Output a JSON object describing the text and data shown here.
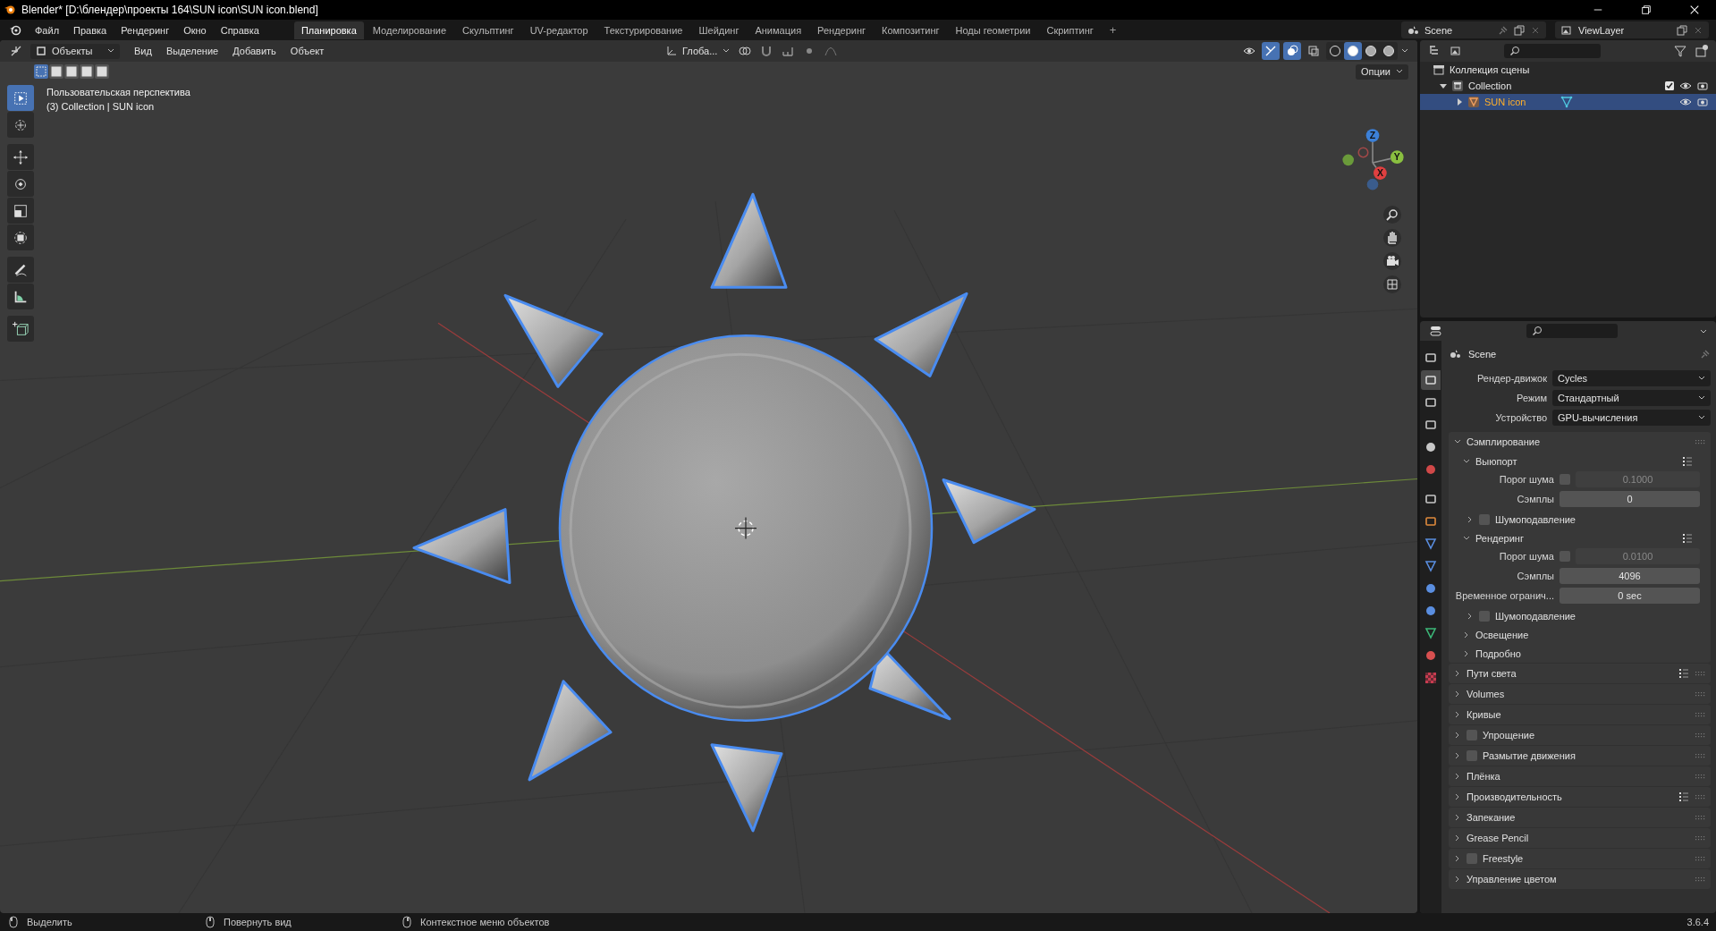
{
  "window": {
    "title": "Blender* [D:\\блендер\\проекты 164\\SUN icon\\SUN icon.blend]"
  },
  "menu": [
    "Файл",
    "Правка",
    "Рендеринг",
    "Окно",
    "Справка"
  ],
  "workspaces": [
    {
      "label": "Планировка",
      "selected": true
    },
    {
      "label": "Моделирование",
      "selected": false
    },
    {
      "label": "Скульптинг",
      "selected": false
    },
    {
      "label": "UV-редактор",
      "selected": false
    },
    {
      "label": "Текстурирование",
      "selected": false
    },
    {
      "label": "Шейдинг",
      "selected": false
    },
    {
      "label": "Анимация",
      "selected": false
    },
    {
      "label": "Рендеринг",
      "selected": false
    },
    {
      "label": "Композитинг",
      "selected": false
    },
    {
      "label": "Ноды геометрии",
      "selected": false
    },
    {
      "label": "Скриптинг",
      "selected": false
    }
  ],
  "add_workspace": "+",
  "scene": {
    "name": "Scene",
    "view_layer": "ViewLayer"
  },
  "viewport": {
    "mode": "Объекты",
    "menus": [
      "Вид",
      "Выделение",
      "Добавить",
      "Объект"
    ],
    "orientation": "Глоба...",
    "gizmos_on": true,
    "overlays_on": true,
    "shading": [
      {
        "selected": false
      },
      {
        "selected": true
      },
      {
        "selected": false
      },
      {
        "selected": false
      }
    ],
    "select_modes": [
      {
        "selected": true
      },
      {
        "selected": false
      },
      {
        "selected": false
      },
      {
        "selected": false
      },
      {
        "selected": false
      }
    ],
    "options": "Опции",
    "view_name": "Пользовательская перспектива",
    "object_info": "(3) Collection | SUN icon",
    "tools": [
      {
        "selected": true
      },
      {
        "selected": false
      },
      {
        "selected": false
      },
      {
        "selected": false
      },
      {
        "selected": false
      },
      {
        "selected": false
      },
      {
        "selected": false
      },
      {
        "selected": false
      },
      {
        "selected": false
      }
    ],
    "gizmo_axes": [
      "Z",
      "X",
      "Y"
    ]
  },
  "outliner": {
    "root": "Коллекция сцены",
    "children": [
      {
        "name": "Collection",
        "expanded": true,
        "checked": true,
        "selected": false,
        "children": [
          {
            "name": "SUN icon",
            "expanded": false,
            "selected": true
          }
        ]
      }
    ]
  },
  "properties": {
    "tabs": [
      {
        "selected": false
      },
      {
        "selected": true
      },
      {
        "selected": false
      },
      {
        "selected": false
      },
      {
        "selected": false
      },
      {
        "selected": false
      },
      {
        "selected": false
      },
      {
        "selected": false
      },
      {
        "selected": false
      },
      {
        "selected": false
      },
      {
        "selected": false
      },
      {
        "selected": false
      },
      {
        "selected": false
      },
      {
        "selected": false
      },
      {
        "selected": false
      }
    ],
    "title": "Scene",
    "fields": [
      {
        "label": "Рендер-движок",
        "value": "Cycles"
      },
      {
        "label": "Режим",
        "value": "Стандартный"
      },
      {
        "label": "Устройство",
        "value": "GPU-вычисления"
      }
    ],
    "panels": [
      {
        "label": "Сэмплирование",
        "expanded": true,
        "children": [
          {
            "label": "Выюпорт",
            "expanded": true,
            "presets": true,
            "rows": [
              {
                "kind": "check-number",
                "label": "Порог шума",
                "checked": false,
                "value": "0.1000"
              },
              {
                "kind": "number",
                "label": "Сэмплы",
                "value": "0"
              }
            ],
            "children": [
              {
                "label": "Шумоподавление",
                "expanded": false,
                "checked": false
              }
            ]
          },
          {
            "label": "Рендеринг",
            "expanded": true,
            "presets": true,
            "rows": [
              {
                "kind": "check-number",
                "label": "Порог шума",
                "checked": false,
                "value": "0.0100"
              },
              {
                "kind": "number",
                "label": "Сэмплы",
                "value": "4096"
              },
              {
                "kind": "number",
                "label": "Временное огранич...",
                "value": "0 sec"
              }
            ],
            "children": [
              {
                "label": "Шумоподавление",
                "expanded": false,
                "checked": false
              }
            ]
          },
          {
            "label": "Освещение",
            "expanded": false
          },
          {
            "label": "Подробно",
            "expanded": false
          }
        ]
      },
      {
        "label": "Пути света",
        "expanded": false,
        "presets": true
      },
      {
        "label": "Volumes",
        "expanded": false
      },
      {
        "label": "Кривые",
        "expanded": false
      },
      {
        "label": "Упрощение",
        "expanded": false,
        "checked": false
      },
      {
        "label": "Размытие движения",
        "expanded": false,
        "checked": false
      },
      {
        "label": "Плёнка",
        "expanded": false
      },
      {
        "label": "Производительность",
        "expanded": false,
        "presets": true
      },
      {
        "label": "Запекание",
        "expanded": false
      },
      {
        "label": "Grease Pencil",
        "expanded": false
      },
      {
        "label": "Freestyle",
        "expanded": false,
        "checked": false
      },
      {
        "label": "Управление цветом",
        "expanded": false
      }
    ]
  },
  "status_bar": {
    "hints": [
      "Выделить",
      "Повернуть вид",
      "Контекстное меню объектов"
    ],
    "version": "3.6.4"
  }
}
